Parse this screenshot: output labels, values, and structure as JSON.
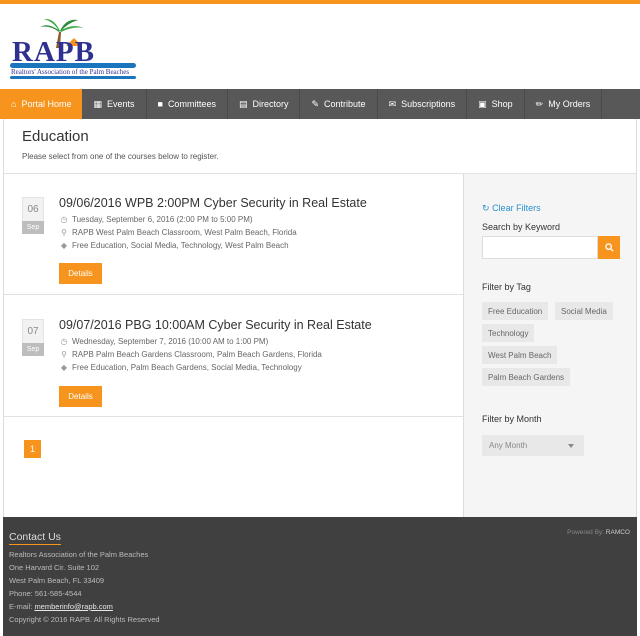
{
  "logo": {
    "text": "RAPB",
    "tagline": "Realtors' Association of the Palm Beaches"
  },
  "nav": [
    {
      "label": "Portal Home",
      "icon": "home-icon",
      "glyph": "⌂",
      "active": true
    },
    {
      "label": "Events",
      "icon": "calendar-icon",
      "glyph": "▦",
      "active": false
    },
    {
      "label": "Committees",
      "icon": "comments-icon",
      "glyph": "■",
      "active": false
    },
    {
      "label": "Directory",
      "icon": "directory-icon",
      "glyph": "▤",
      "active": false
    },
    {
      "label": "Contribute",
      "icon": "edit-icon",
      "glyph": "✎",
      "active": false
    },
    {
      "label": "Subscriptions",
      "icon": "envelope-icon",
      "glyph": "✉",
      "active": false
    },
    {
      "label": "Shop",
      "icon": "cart-icon",
      "glyph": "▣",
      "active": false
    },
    {
      "label": "My Orders",
      "icon": "pin-icon",
      "glyph": "✏",
      "active": false
    }
  ],
  "page": {
    "title": "Education",
    "subtitle": "Please select from one of the courses below to register."
  },
  "events": [
    {
      "day": "06",
      "month": "Sep",
      "title": "09/06/2016 WPB 2:00PM Cyber Security in Real Estate",
      "datetime": "Tuesday, September 6, 2016 (2:00 PM to 5:00 PM)",
      "location": "RAPB West Palm Beach Classroom, West Palm Beach, Florida",
      "tags": "Free Education, Social Media, Technology, West Palm Beach",
      "button": "Details"
    },
    {
      "day": "07",
      "month": "Sep",
      "title": "09/07/2016 PBG 10:00AM Cyber Security in Real Estate",
      "datetime": "Wednesday, September 7, 2016 (10:00 AM to 1:00 PM)",
      "location": "RAPB Palm Beach Gardens Classroom, Palm Beach Gardens, Florida",
      "tags": "Free Education, Palm Beach Gardens, Social Media, Technology",
      "button": "Details"
    }
  ],
  "pagination": {
    "current": "1"
  },
  "sidebar": {
    "clear_filters": "Clear Filters",
    "search_label": "Search by Keyword",
    "search_value": "",
    "tag_label": "Filter by Tag",
    "tags": [
      "Free Education",
      "Social Media",
      "Technology",
      "West Palm Beach",
      "Palm Beach Gardens"
    ],
    "month_label": "Filter by Month",
    "month_value": "Any Month"
  },
  "footer": {
    "title": "Contact Us",
    "org": "Realtors Association of the Palm Beaches",
    "address1": "One Harvard Cir. Suite 102",
    "address2": "West Palm Beach, FL 33409",
    "phone": "Phone: 561-585-4544",
    "email_label": "E-mail:",
    "email": "memberinfo@rapb.com",
    "copyright": "Copyright © 2016 RAPB. All Rights Reserved",
    "powered_label": "Powered By:",
    "powered_by": "RAMCO"
  },
  "colors": {
    "accent": "#f7941d",
    "nav": "#585858",
    "footer": "#404040",
    "link": "#2a8fcf",
    "brand": "#2e3192"
  }
}
